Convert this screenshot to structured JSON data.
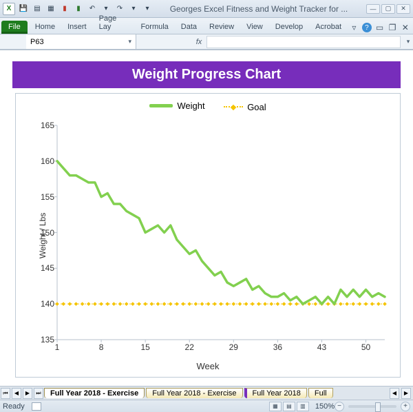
{
  "window": {
    "title": "Georges Excel Fitness and Weight Tracker for ..."
  },
  "ribbon": {
    "file": "File",
    "tabs": [
      "Home",
      "Insert",
      "Page Lay",
      "Formula",
      "Data",
      "Review",
      "View",
      "Develop",
      "Acrobat"
    ]
  },
  "fx": {
    "namebox": "P63",
    "fx_label": "fx"
  },
  "chart_data": {
    "type": "line",
    "title": "Weight Progress Chart",
    "xlabel": "Week",
    "ylabel": "Weight / Lbs",
    "ylim": [
      135,
      165
    ],
    "xlim": [
      1,
      53
    ],
    "y_ticks": [
      135,
      140,
      145,
      150,
      155,
      160,
      165
    ],
    "x_ticks": [
      1,
      8,
      15,
      22,
      29,
      36,
      43,
      50
    ],
    "legend": [
      "Weight",
      "Goal"
    ],
    "series": [
      {
        "name": "Weight",
        "color": "#82d04f",
        "x": [
          1,
          2,
          3,
          4,
          5,
          6,
          7,
          8,
          9,
          10,
          11,
          12,
          13,
          14,
          15,
          16,
          17,
          18,
          19,
          20,
          21,
          22,
          23,
          24,
          25,
          26,
          27,
          28,
          29,
          30,
          31,
          32,
          33,
          34,
          35,
          36,
          37,
          38,
          39,
          40,
          41,
          42,
          43,
          44,
          45,
          46,
          47,
          48,
          49,
          50,
          51,
          52,
          53
        ],
        "values": [
          160,
          159,
          158,
          158,
          157.5,
          157,
          157,
          155,
          155.5,
          154,
          154,
          153,
          152.5,
          152,
          150,
          150.5,
          151,
          150,
          151,
          149,
          148,
          147,
          147.5,
          146,
          145,
          144,
          144.5,
          143,
          142.5,
          143,
          143.5,
          142,
          142.5,
          141.5,
          141,
          141,
          141.5,
          140.5,
          141,
          140,
          140.5,
          141,
          140,
          141,
          140,
          142,
          141,
          142,
          141,
          142,
          141,
          141.5,
          141
        ]
      },
      {
        "name": "Goal",
        "color": "#f5c400",
        "style": "dotted",
        "x": [
          1,
          53
        ],
        "values": [
          140,
          140
        ]
      }
    ]
  },
  "sheet_tabs": {
    "items": [
      "Full Year 2018 - Exercise",
      "Full Year 2018 - Exercise",
      "Full Year 2018",
      "Full"
    ],
    "active_index": 0
  },
  "status": {
    "ready": "Ready",
    "zoom": "150%"
  }
}
